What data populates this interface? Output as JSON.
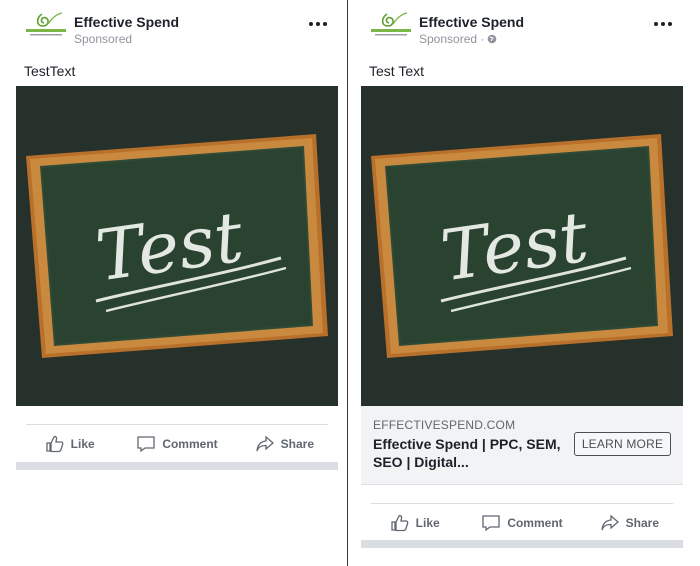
{
  "colors": {
    "chalkboard": "#25312a",
    "frame": "#b8702a",
    "chalk": "#e4e8e2",
    "text_muted": "#606770",
    "separator": "#dadde1"
  },
  "posts": [
    {
      "page_name": "Effective Spend",
      "sponsored": "Sponsored",
      "show_globe": false,
      "post_text": "TestText",
      "board_text": "Test",
      "actions": {
        "like": "Like",
        "comment": "Comment",
        "share": "Share"
      },
      "icons": [
        "like-icon",
        "comment-icon",
        "share-icon",
        "more-options-icon"
      ]
    },
    {
      "page_name": "Effective Spend",
      "sponsored": "Sponsored · ",
      "show_globe": true,
      "post_text": "Test Text",
      "board_text": "Test",
      "link": {
        "domain": "EFFECTIVESPEND.COM",
        "title": "Effective Spend | PPC, SEM, SEO | Digital...",
        "cta": "LEARN MORE"
      },
      "actions": {
        "like": "Like",
        "comment": "Comment",
        "share": "Share"
      },
      "icons": [
        "like-icon",
        "comment-icon",
        "share-icon",
        "more-options-icon",
        "globe-icon"
      ]
    }
  ]
}
